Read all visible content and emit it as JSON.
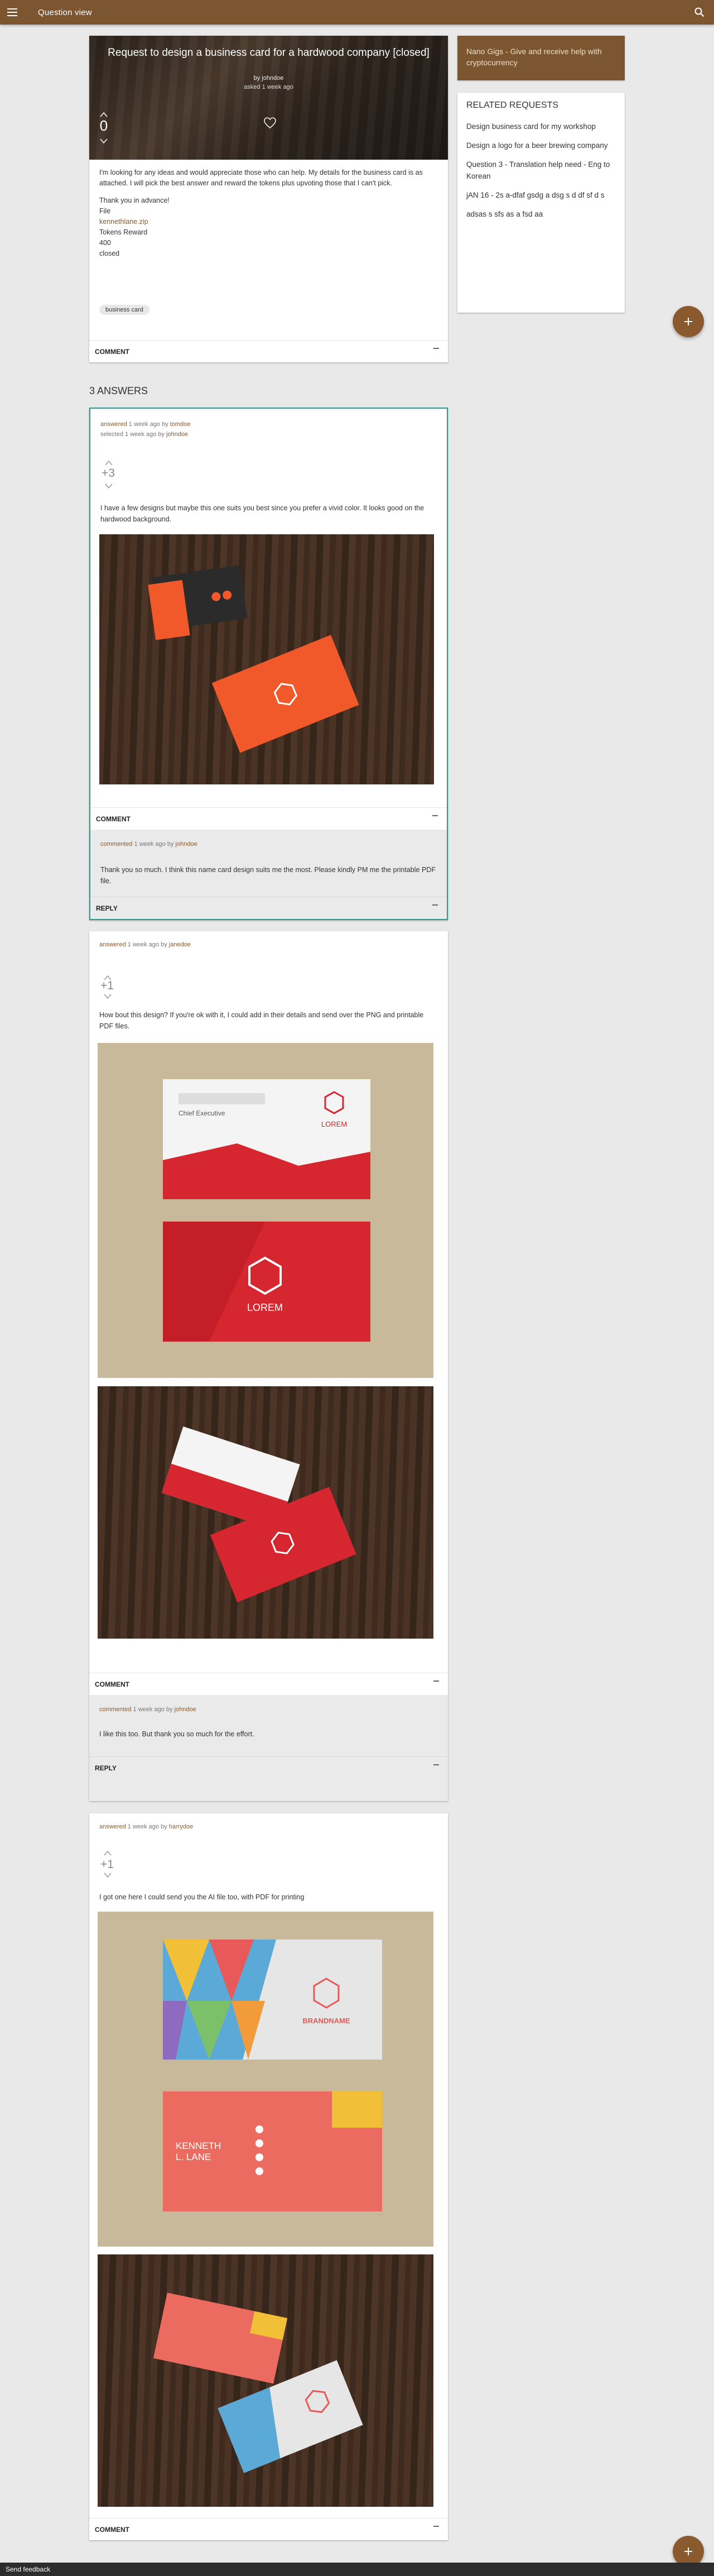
{
  "topbar": {
    "title": "Question view"
  },
  "question": {
    "title": "Request to design a business card for a hardwood company [closed]",
    "byline": "by johndoe",
    "asked": "asked 1 week ago",
    "votes": "0",
    "body": "I'm looking for any ideas and would appreciate those who can help. My details for the business card is as attached. I will pick the best answer and reward the tokens plus upvoting those that I can't pick.",
    "thanks": "Thank you in advance!",
    "file_label": "File",
    "file_link": "kennethlane.zip",
    "reward_label": "Tokens Reward",
    "reward_value": "400",
    "status": "closed",
    "tag": "business card",
    "comment_label": "COMMENT"
  },
  "sidebar": {
    "promo": "Nano Gigs - Give and receive help with cryptocurrency",
    "related_heading": "RELATED REQUESTS",
    "related": [
      "Design business card for my workshop",
      "Design a logo for a beer brewing company",
      "Question 3 - Translation help need - Eng to Korean",
      "jAN 16 - 2s a-dfaf gsdg a dsg s d df sf d s",
      "adsas s sfs as a fsd aa"
    ]
  },
  "answers_heading": "3 ANSWERS",
  "answers": [
    {
      "meta_action": "answered",
      "meta_time": "1 week ago by",
      "meta_user": "tomdoe",
      "selected_time": "selected 1 week ago by",
      "selected_user": "johndoe",
      "votes": "+3",
      "text": "I have a few designs but maybe this one suits you best since you prefer a vivid color. It looks good on the hardwood background.",
      "comment_label": "COMMENT",
      "comment_meta_action": "commented",
      "comment_meta_time": "1 week ago by",
      "comment_user": "johndoe",
      "comment_text": "Thank you so much. I think this name card design suits me the most. Please kindly PM me the printable PDF file.",
      "reply_label": "REPLY"
    },
    {
      "meta_action": "answered",
      "meta_time": "1 week ago by",
      "meta_user": "janedoe",
      "votes": "+1",
      "text": "How bout this design? If you're ok with it, I could add in their details and send over the PNG and printable PDF files.",
      "card_role": "Chief Executive",
      "card_brand": "LOREM",
      "comment_label": "COMMENT",
      "comment_meta_action": "commented",
      "comment_meta_time": "1 week ago by",
      "comment_user": "johndoe",
      "comment_text": "I like this too. But thank you so much for the effort.",
      "reply_label": "REPLY"
    },
    {
      "meta_action": "answered",
      "meta_time": "1 week ago by",
      "meta_user": "harrydoe",
      "votes": "+1",
      "text": "I got one here  I could send you the AI file too, with PDF for printing",
      "card_brand": "BRANDNAME",
      "card_name_1": "KENNETH",
      "card_name_2": "L. LANE",
      "comment_label": "COMMENT"
    }
  ],
  "footer": {
    "feedback": "Send feedback"
  },
  "colors": {
    "brand": "#7b5630",
    "accent": "#8a5a2e",
    "selected_border": "#2a9d8f",
    "orange_card": "#f2592a",
    "red_card": "#d6262f"
  }
}
